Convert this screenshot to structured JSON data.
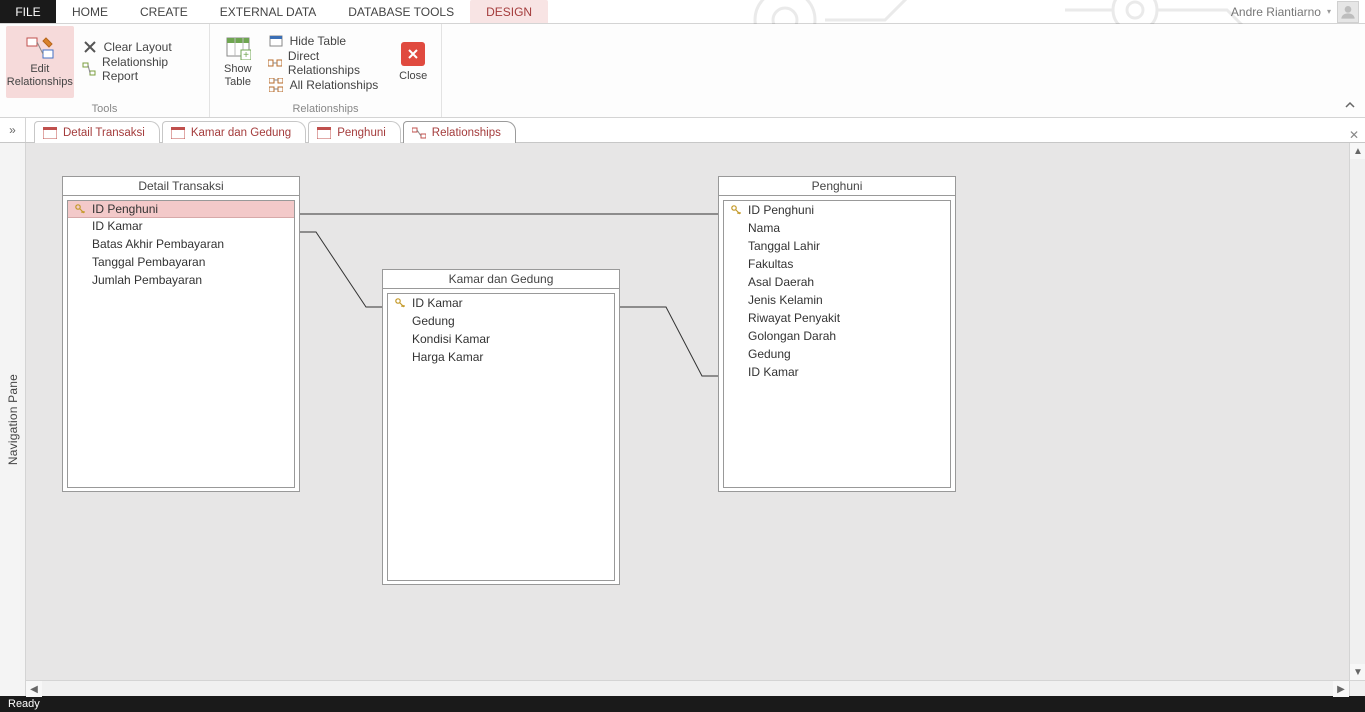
{
  "menu": {
    "file": "FILE",
    "items": [
      "HOME",
      "CREATE",
      "EXTERNAL DATA",
      "DATABASE TOOLS",
      "DESIGN"
    ]
  },
  "user": {
    "name": "Andre Riantiarno"
  },
  "ribbon": {
    "groups": {
      "tools": {
        "label": "Tools",
        "edit_relationships": "Edit Relationships",
        "clear_layout": "Clear Layout",
        "relationship_report": "Relationship Report"
      },
      "show_table_btn": "Show Table",
      "rel_group": {
        "label": "Relationships",
        "hide_table": "Hide Table",
        "direct": "Direct Relationships",
        "all": "All Relationships"
      },
      "close": "Close"
    }
  },
  "doc_tabs": [
    {
      "label": "Detail Transaksi"
    },
    {
      "label": "Kamar dan Gedung"
    },
    {
      "label": "Penghuni"
    },
    {
      "label": "Relationships"
    }
  ],
  "nav_pane_label": "Navigation Pane",
  "tables": {
    "detail": {
      "title": "Detail Transaksi",
      "fields": [
        "ID Penghuni",
        "ID Kamar",
        "Batas Akhir Pembayaran",
        "Tanggal Pembayaran",
        "Jumlah Pembayaran"
      ]
    },
    "kamar": {
      "title": "Kamar dan Gedung",
      "fields": [
        "ID Kamar",
        "Gedung",
        "Kondisi Kamar",
        "Harga Kamar"
      ]
    },
    "penghuni": {
      "title": "Penghuni",
      "fields": [
        "ID Penghuni",
        "Nama",
        "Tanggal Lahir",
        "Fakultas",
        "Asal Daerah",
        "Jenis Kelamin",
        "Riwayat Penyakit",
        "Golongan Darah",
        "Gedung",
        "ID Kamar"
      ]
    }
  },
  "status_text": "Ready"
}
